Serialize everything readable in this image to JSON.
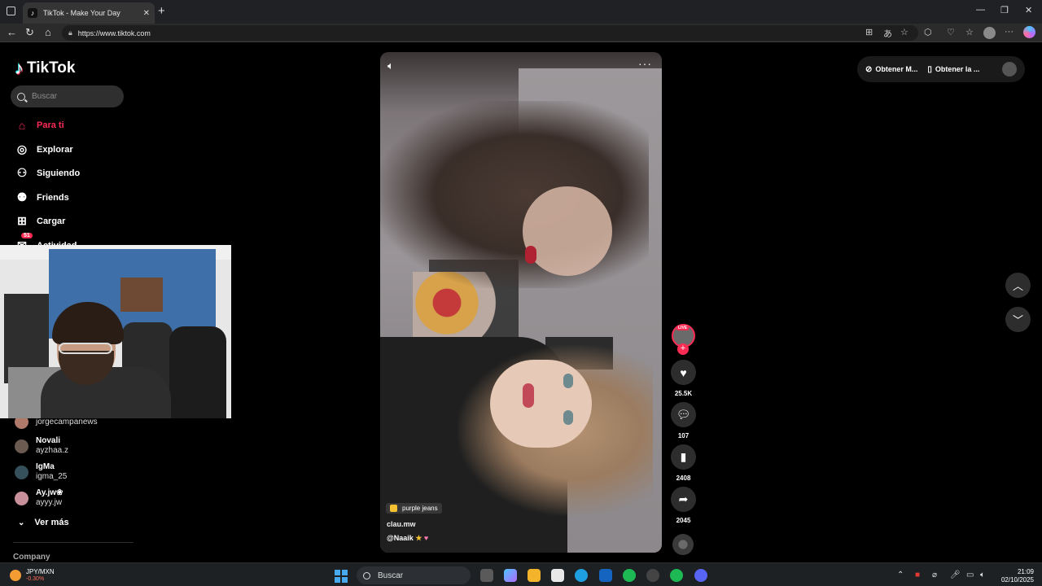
{
  "browser": {
    "tab_title": "TikTok - Make Your Day",
    "tab_favicon": "♪",
    "url": "https://www.tiktok.com"
  },
  "sidebar": {
    "brand": "TikTok",
    "search_placeholder": "Buscar",
    "items": [
      {
        "label": "Para ti",
        "icon": "home-icon",
        "active": true
      },
      {
        "label": "Explorar",
        "icon": "compass-icon"
      },
      {
        "label": "Siguiendo",
        "icon": "following-icon"
      },
      {
        "label": "Friends",
        "icon": "friends-icon"
      },
      {
        "label": "Cargar",
        "icon": "upload-icon"
      },
      {
        "label": "Actividad",
        "icon": "activity-icon",
        "badge": "51"
      }
    ],
    "following": [
      {
        "handle": "jorgecampanews"
      },
      {
        "name": "Novali",
        "handle": "ayzhaa.z"
      },
      {
        "name": "IgMa",
        "handle": "igma_25"
      },
      {
        "name": "Ay.jw❀",
        "handle": "ayyy.jw"
      }
    ],
    "see_more": "Ver más",
    "footer_heading": "Company"
  },
  "video": {
    "music": "purple jeans",
    "author": "clau.mw",
    "caption": "@Naaik",
    "likes": "25.5K",
    "comments": "107",
    "saves": "2408",
    "shares": "2045",
    "live_tag": "LIVE"
  },
  "topbar": {
    "get_coins": "Obtener M...",
    "get_app": "Obtener la ..."
  },
  "taskbar": {
    "stock_name": "JPY/MXN",
    "stock_change": "-0.30%",
    "search_placeholder": "Buscar",
    "time": "21:09",
    "date": "02/10/2025"
  },
  "colors": {
    "accent": "#fe2c55",
    "background": "#000000",
    "panel": "#2d2d2d"
  }
}
